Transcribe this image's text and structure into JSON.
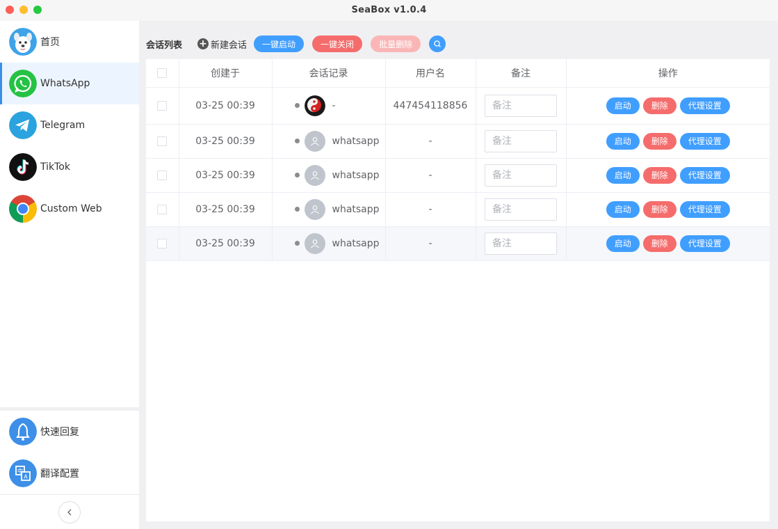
{
  "window": {
    "title": "SeaBox v1.0.4"
  },
  "sidebar": {
    "items": [
      {
        "label": "首页",
        "icon": "dog-logo-icon"
      },
      {
        "label": "WhatsApp",
        "icon": "whatsapp-icon",
        "active": true
      },
      {
        "label": "Telegram",
        "icon": "telegram-icon"
      },
      {
        "label": "TikTok",
        "icon": "tiktok-icon"
      },
      {
        "label": "Custom Web",
        "icon": "chrome-icon"
      }
    ],
    "bottom_items": [
      {
        "label": "快速回复",
        "icon": "bell-icon"
      },
      {
        "label": "翻译配置",
        "icon": "translate-icon"
      }
    ]
  },
  "toolbar": {
    "title": "会话列表",
    "new_session": "新建会话",
    "start_all": "一键启动",
    "close_all": "一键关闭",
    "batch_delete": "批量删除"
  },
  "table": {
    "columns": [
      "创建于",
      "会话记录",
      "用户名",
      "备注",
      "操作"
    ],
    "note_placeholder": "备注",
    "actions": {
      "start": "启动",
      "delete": "删除",
      "proxy": "代理设置"
    },
    "rows": [
      {
        "created": "03-25 00:39",
        "session": "-",
        "username": "447454118856"
      },
      {
        "created": "03-25 00:39",
        "session": "whatsapp",
        "username": "-"
      },
      {
        "created": "03-25 00:39",
        "session": "whatsapp",
        "username": "-"
      },
      {
        "created": "03-25 00:39",
        "session": "whatsapp",
        "username": "-"
      },
      {
        "created": "03-25 00:39",
        "session": "whatsapp",
        "username": "-"
      }
    ]
  },
  "colors": {
    "primary": "#409eff",
    "danger": "#f56c6c",
    "danger_disabled": "#fab6b6",
    "active_nav_bg": "#ecf5ff"
  }
}
